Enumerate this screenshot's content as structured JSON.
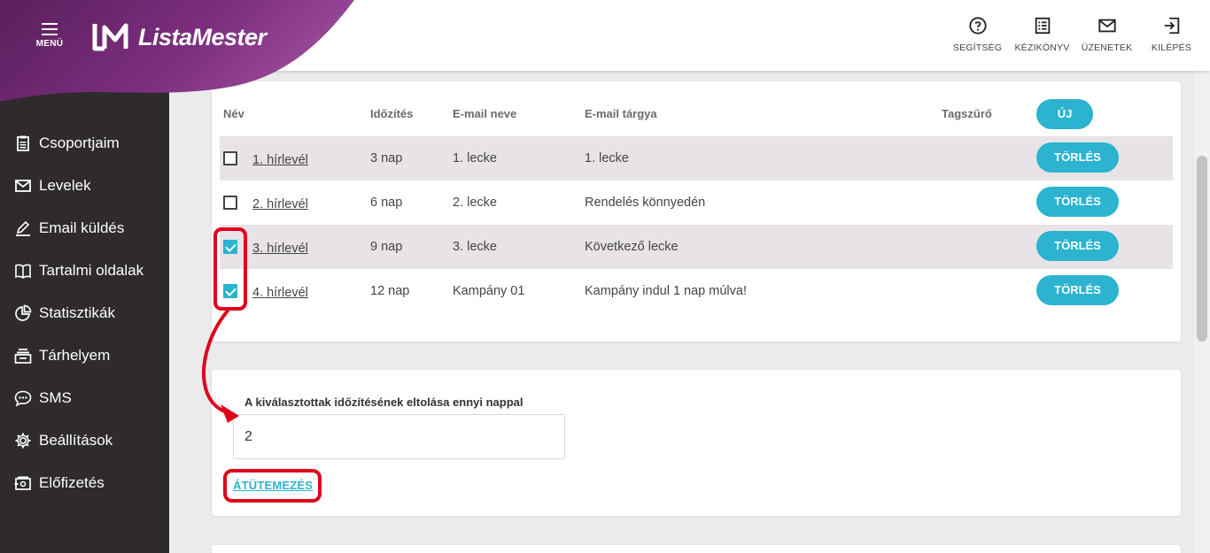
{
  "header": {
    "menu_label": "MENÜ",
    "brand": "ListaMester",
    "nav": [
      {
        "label": "SEGÍTSÉG",
        "icon": "help-circle-icon"
      },
      {
        "label": "KÉZIKÖNYV",
        "icon": "manual-icon"
      },
      {
        "label": "ÜZENETEK",
        "icon": "mail-icon"
      },
      {
        "label": "KILÉPÉS",
        "icon": "logout-icon"
      }
    ]
  },
  "sidebar": {
    "items": [
      {
        "label": "Csoportjaim",
        "icon": "clipboard-icon"
      },
      {
        "label": "Levelek",
        "icon": "envelope-icon"
      },
      {
        "label": "Email küldés",
        "icon": "pen-icon"
      },
      {
        "label": "Tartalmi oldalak",
        "icon": "book-icon"
      },
      {
        "label": "Statisztikák",
        "icon": "pie-chart-icon"
      },
      {
        "label": "Tárhelyem",
        "icon": "storage-icon"
      },
      {
        "label": "SMS",
        "icon": "chat-bubble-icon"
      },
      {
        "label": "Beállítások",
        "icon": "gear-icon"
      },
      {
        "label": "Előfizetés",
        "icon": "subscription-icon"
      }
    ]
  },
  "table": {
    "headers": {
      "name": "Név",
      "timing": "Időzítés",
      "email_name": "E-mail neve",
      "email_subject": "E-mail tárgya",
      "tag_filter": "Tagszűrő"
    },
    "new_button": "ÚJ",
    "delete_label": "TÖRLÉS",
    "rows": [
      {
        "name": "1. hírlevél",
        "timing": "3 nap",
        "email_name": "1. lecke",
        "subject": "1. lecke",
        "checked": false
      },
      {
        "name": "2. hírlevél",
        "timing": "6 nap",
        "email_name": "2. lecke",
        "subject": "Rendelés könnyedén",
        "checked": false
      },
      {
        "name": "3. hírlevél",
        "timing": "9 nap",
        "email_name": "3. lecke",
        "subject": "Következő lecke",
        "checked": true
      },
      {
        "name": "4. hírlevél",
        "timing": "12 nap",
        "email_name": "Kampány 01",
        "subject": "Kampány indul 1 nap múlva!",
        "checked": true
      }
    ]
  },
  "reschedule": {
    "label": "A kiválasztottak időzítésének eltolása ennyi nappal",
    "value": "2",
    "button": "ÁTÜTEMEZÉS"
  },
  "colors": {
    "accent": "#2bb3cf",
    "brand_purple": "#7a2f79",
    "sidebar_bg": "#2e2a2e",
    "annotation_red": "#e0001b"
  }
}
